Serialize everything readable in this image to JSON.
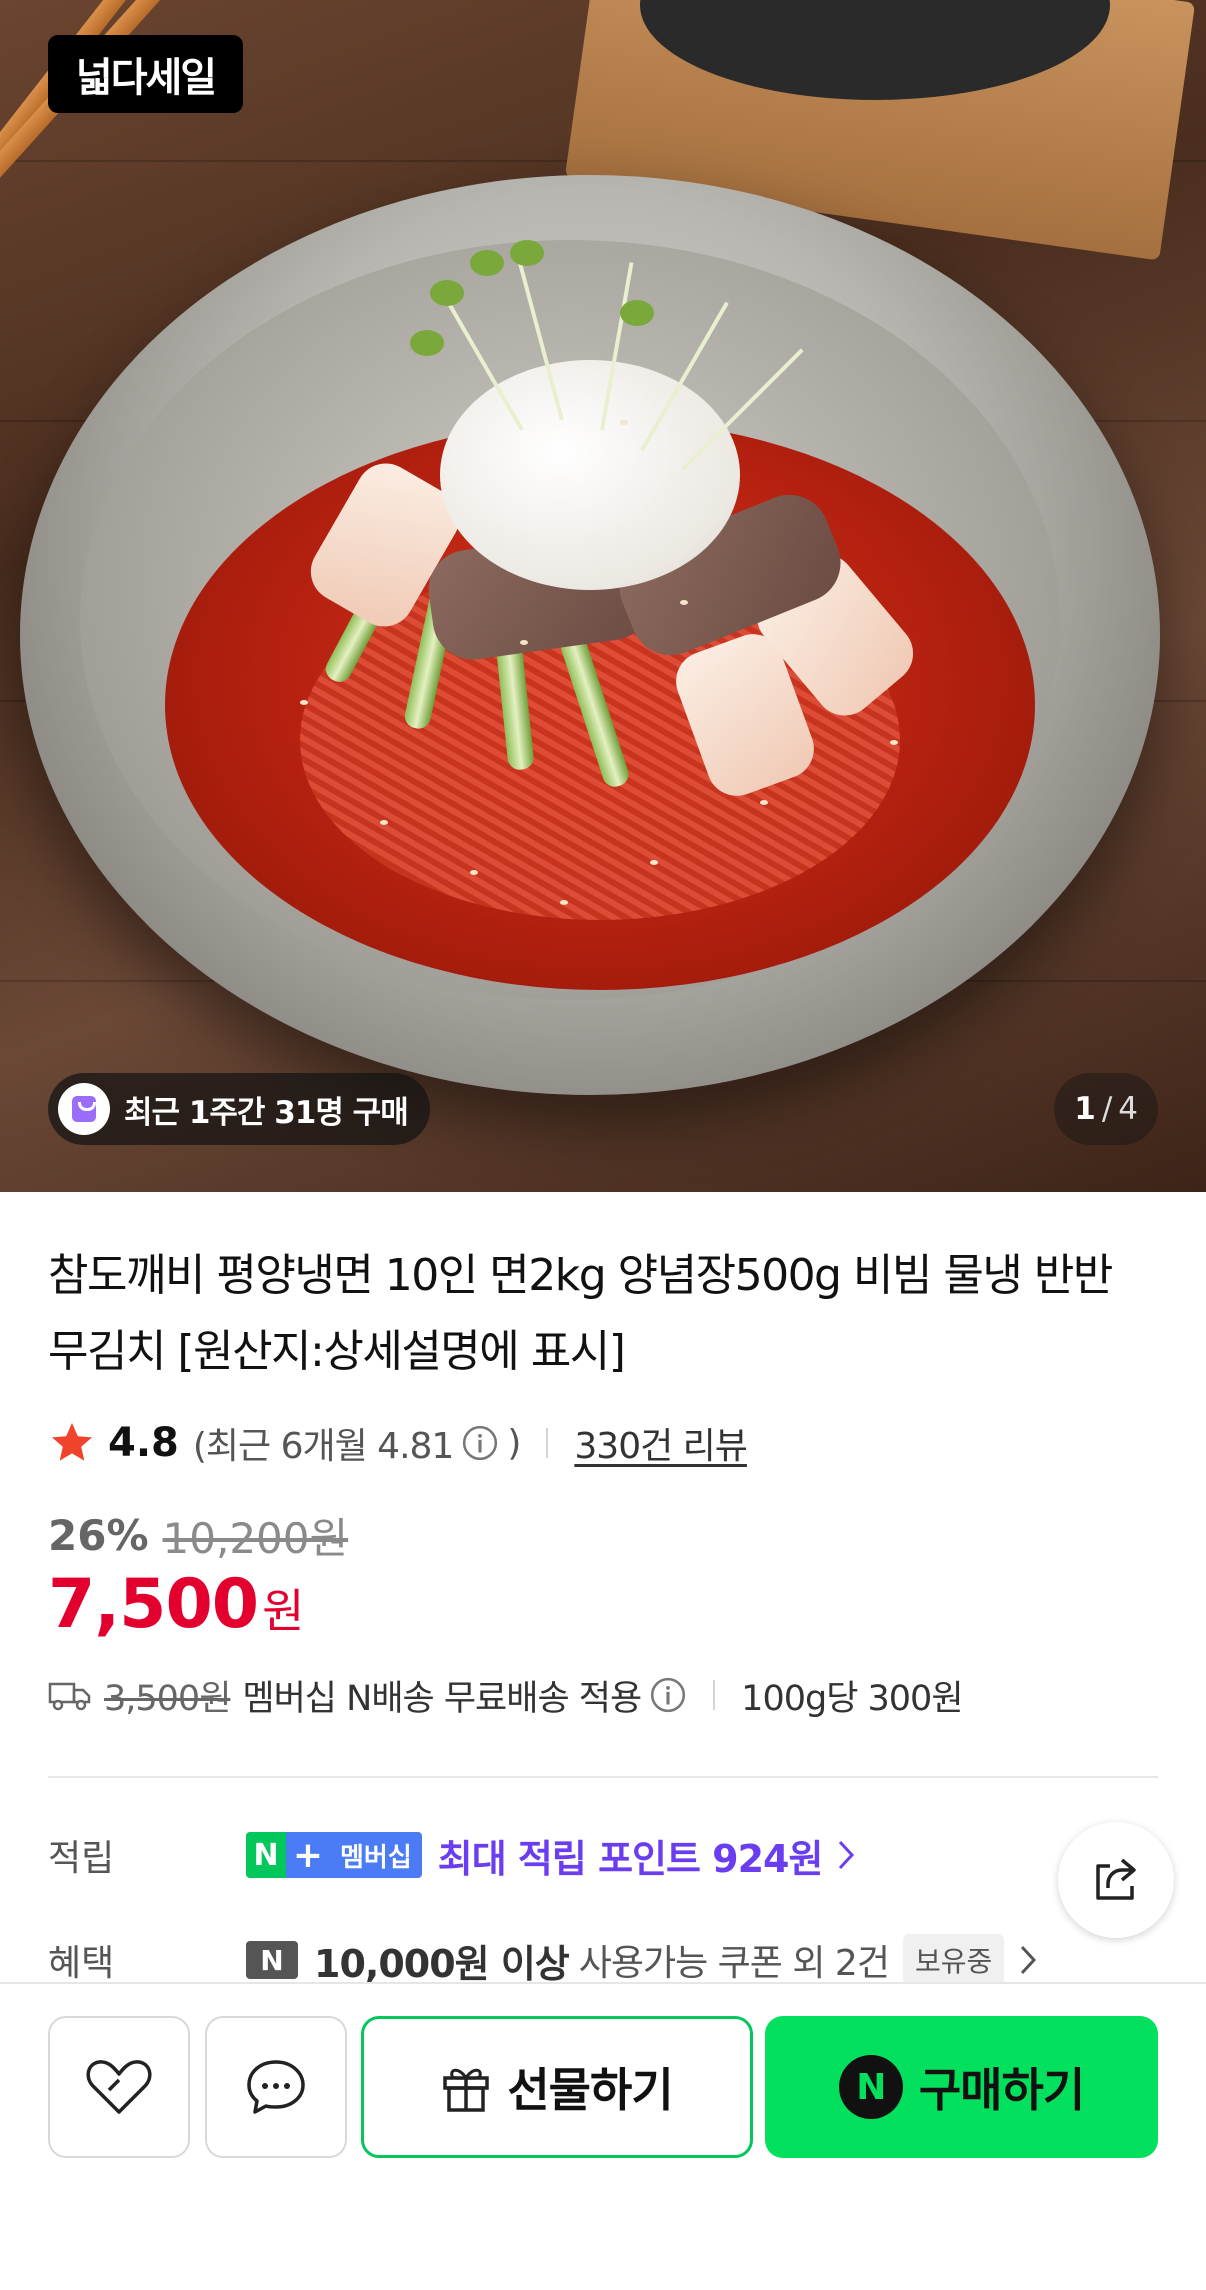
{
  "hero": {
    "brand_logo": "넓다세일",
    "purchase_badge": "최근 1주간 31명 구매",
    "page_current": "1",
    "page_separator": "/",
    "page_total": "4"
  },
  "product": {
    "title": "참도깨비 평양냉면 10인 면2kg 양념장500g 비빔 물냉 반반 무김치 [원산지:상세설명에 표시]",
    "rating": "4.8",
    "rating_recent_prefix": "(최근 6개월 4.81",
    "rating_recent_suffix": ")",
    "review_count": "330건 리뷰",
    "discount_rate": "26%",
    "original_price": "10,200원",
    "sale_price": "7,500",
    "currency": "원",
    "shipping_original": "3,500원",
    "shipping_text": "멤버십 N배송 무료배송 적용",
    "unit_price": "100g당 300원"
  },
  "benefits": {
    "points_label": "적립",
    "npay_n": "N",
    "npay_plus": "+",
    "membership_tag": "멤버십",
    "points_text": "최대 적립 포인트 924원",
    "coupon_label": "혜택",
    "coupon_n": "N",
    "coupon_bold": "10,000원 이상",
    "coupon_text": "사용가능 쿠폰 외 2건",
    "owned_tag": "보유중"
  },
  "bottom_bar": {
    "gift_label": "선물하기",
    "buy_n": "N",
    "buy_label": "구매하기"
  },
  "icons": {
    "star": "star-icon",
    "info": "info-icon",
    "truck": "truck-icon",
    "share": "share-icon",
    "wish": "heart-icon",
    "chat": "chat-bubble-icon",
    "gift": "gift-icon",
    "chevron": "chevron-right-icon"
  },
  "colors": {
    "sale_red": "#e3002e",
    "naver_green": "#03c75a",
    "buy_green": "#03e05e",
    "points_purple": "#6a3df0",
    "star_red": "#f0432c"
  }
}
